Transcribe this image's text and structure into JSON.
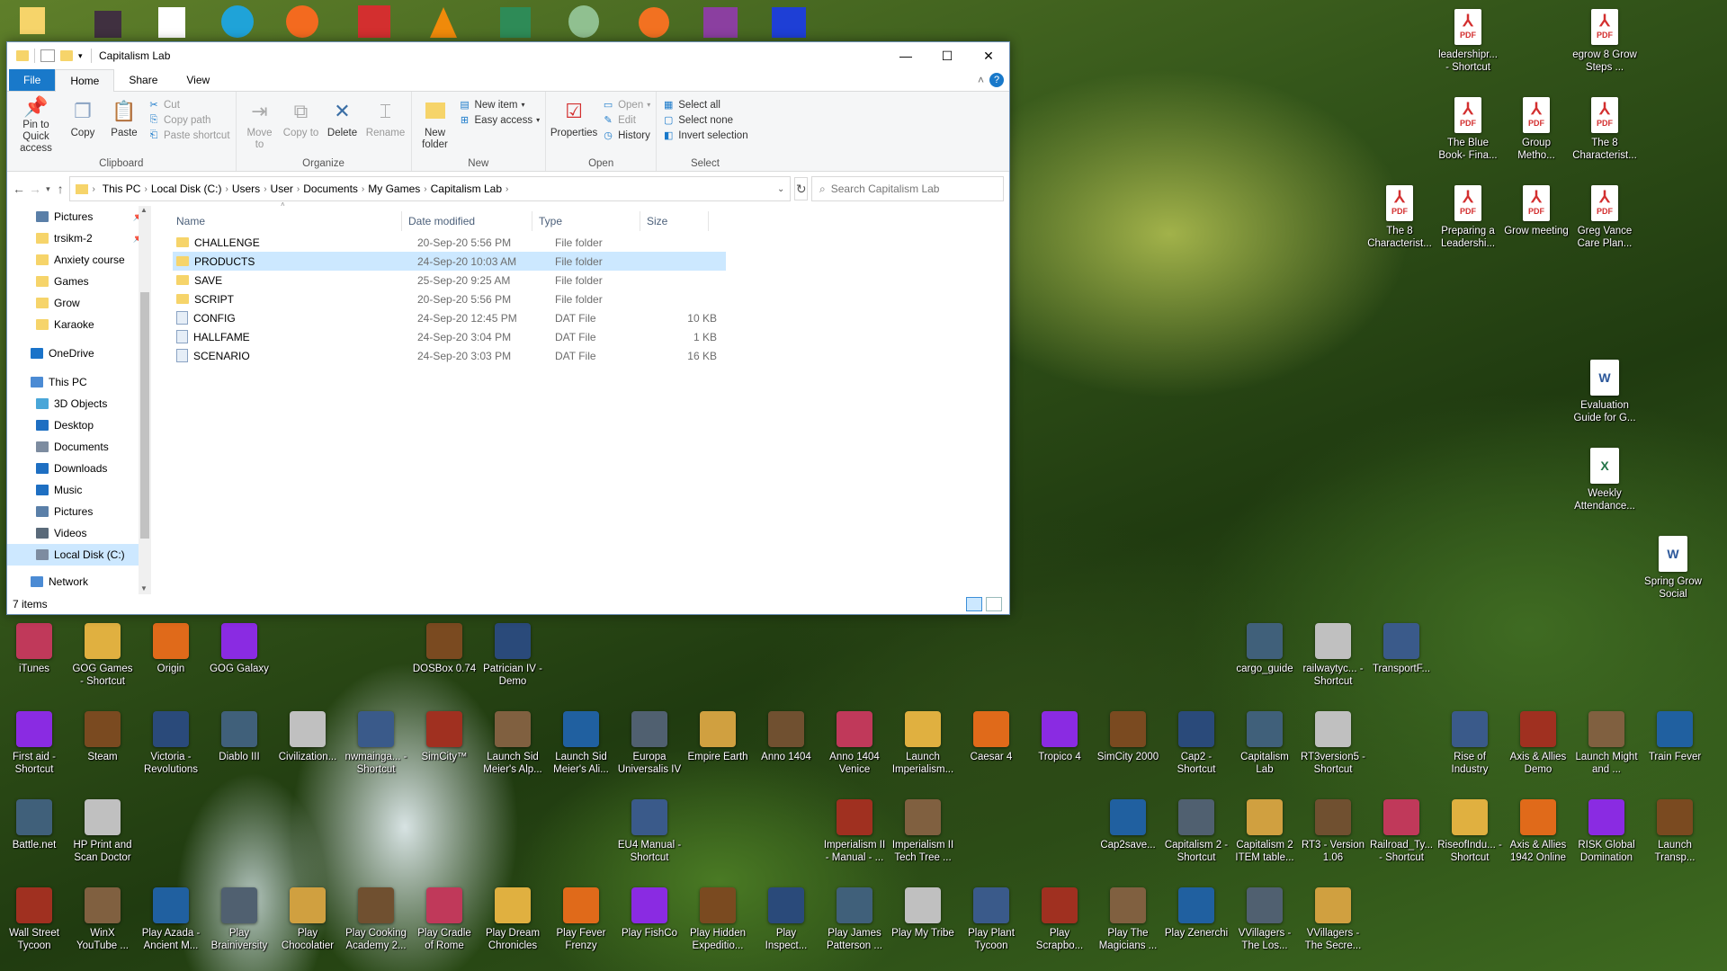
{
  "window": {
    "title": "Capitalism Lab",
    "tabs": [
      "File",
      "Home",
      "Share",
      "View"
    ],
    "help_icon": "?"
  },
  "ribbon": {
    "clipboard": {
      "name": "Clipboard",
      "pin": "Pin to Quick access",
      "copy": "Copy",
      "paste": "Paste",
      "cut": "Cut",
      "copy_path": "Copy path",
      "paste_shortcut": "Paste shortcut"
    },
    "organize": {
      "name": "Organize",
      "move_to": "Move to",
      "copy_to": "Copy to",
      "delete": "Delete",
      "rename": "Rename"
    },
    "new": {
      "name": "New",
      "new_folder": "New folder",
      "new_item": "New item",
      "easy_access": "Easy access"
    },
    "open": {
      "name": "Open",
      "properties": "Properties",
      "open": "Open",
      "edit": "Edit",
      "history": "History"
    },
    "select": {
      "name": "Select",
      "select_all": "Select all",
      "select_none": "Select none",
      "invert": "Invert selection"
    }
  },
  "address": {
    "crumbs": [
      "This PC",
      "Local Disk (C:)",
      "Users",
      "User",
      "Documents",
      "My Games",
      "Capitalism Lab"
    ],
    "search_placeholder": "Search Capitalism Lab"
  },
  "nav": {
    "quick": [
      {
        "label": "Pictures",
        "pinned": true
      },
      {
        "label": "trsikm-2",
        "pinned": true
      },
      {
        "label": "Anxiety course",
        "pinned": false
      },
      {
        "label": "Games",
        "pinned": false
      },
      {
        "label": "Grow",
        "pinned": false
      },
      {
        "label": "Karaoke",
        "pinned": false
      }
    ],
    "onedrive": "OneDrive",
    "thispc": "This PC",
    "pc_items": [
      "3D Objects",
      "Desktop",
      "Documents",
      "Downloads",
      "Music",
      "Pictures",
      "Videos",
      "Local Disk (C:)"
    ],
    "network": "Network"
  },
  "columns": {
    "name": "Name",
    "date": "Date modified",
    "type": "Type",
    "size": "Size"
  },
  "files": [
    {
      "name": "CHALLENGE",
      "date": "20-Sep-20 5:56 PM",
      "type": "File folder",
      "size": ""
    },
    {
      "name": "PRODUCTS",
      "date": "24-Sep-20 10:03 AM",
      "type": "File folder",
      "size": ""
    },
    {
      "name": "SAVE",
      "date": "25-Sep-20 9:25 AM",
      "type": "File folder",
      "size": ""
    },
    {
      "name": "SCRIPT",
      "date": "20-Sep-20 5:56 PM",
      "type": "File folder",
      "size": ""
    },
    {
      "name": "CONFIG",
      "date": "24-Sep-20 12:45 PM",
      "type": "DAT File",
      "size": "10 KB"
    },
    {
      "name": "HALLFAME",
      "date": "24-Sep-20 3:04 PM",
      "type": "DAT File",
      "size": "1 KB"
    },
    {
      "name": "SCENARIO",
      "date": "24-Sep-20 3:03 PM",
      "type": "DAT File",
      "size": "16 KB"
    }
  ],
  "status": "7 items",
  "desktop_right": [
    {
      "label": "leadershipr... - Shortcut",
      "kind": "pdf"
    },
    {
      "label": "egrow 8 Grow Steps ...",
      "kind": "pdf"
    },
    {
      "label": "The Blue Book- Fina...",
      "kind": "pdf"
    },
    {
      "label": "Group Metho...",
      "kind": "pdf"
    },
    {
      "label": "The 8 Characterist...",
      "kind": "pdf"
    },
    {
      "label": "The 8 Characterist...",
      "kind": "pdf"
    },
    {
      "label": "Preparing a Leadershi...",
      "kind": "pdf"
    },
    {
      "label": "Grow meeting",
      "kind": "pdf"
    },
    {
      "label": "Greg Vance Care Plan...",
      "kind": "pdf"
    },
    {
      "label": "Evaluation Guide for G...",
      "kind": "doc"
    },
    {
      "label": "Weekly Attendance...",
      "kind": "xls"
    },
    {
      "label": "Spring Grow Social",
      "kind": "doc"
    }
  ],
  "desktop_row1": [
    "iTunes",
    "GOG Games - Shortcut",
    "Origin",
    "GOG Galaxy",
    "DOSBox 0.74",
    "Patrician IV - Demo",
    "cargo_guide",
    "railwaytyc... - Shortcut",
    "TransportF..."
  ],
  "desktop_row2": [
    "First aid - Shortcut",
    "Steam",
    "Victoria - Revolutions",
    "Diablo III",
    "Civilization...",
    "nwmainga... - Shortcut",
    "SimCity™",
    "Launch Sid Meier's Alp...",
    "Launch Sid Meier's Ali...",
    "Europa Universalis IV",
    "Empire Earth",
    "Anno 1404",
    "Anno 1404 Venice",
    "Launch Imperialism...",
    "Caesar 4",
    "Tropico 4",
    "SimCity 2000",
    "Cap2 - Shortcut",
    "Capitalism Lab",
    "RT3version5 - Shortcut",
    "Rise of Industry",
    "Axis & Allies Demo",
    "Launch Might and ...",
    "Train Fever"
  ],
  "desktop_row3": [
    "Battle.net",
    "HP Print and Scan Doctor",
    "EU4 Manual - Shortcut",
    "Imperialism II - Manual - ...",
    "Imperialism II Tech Tree ...",
    "Cap2save...",
    "Capitalism 2 - Shortcut",
    "Capitalism 2 ITEM table...",
    "RT3 - Version 1.06",
    "Railroad_Ty... - Shortcut",
    "RiseofIndu... - Shortcut",
    "Axis & Allies 1942 Online",
    "RISK Global Domination",
    "Launch Transp..."
  ],
  "desktop_row4": [
    "Wall Street Tycoon",
    "WinX YouTube ...",
    "Play Azada - Ancient M...",
    "Play Brainiversity",
    "Play Chocolatier",
    "Play Cooking Academy 2...",
    "Play Cradle of Rome",
    "Play Dream Chronicles",
    "Play Fever Frenzy",
    "Play FishCo",
    "Play Hidden Expeditio...",
    "Play Inspect...",
    "Play James Patterson ...",
    "Play My Tribe",
    "Play Plant Tycoon",
    "Play Scrapbo...",
    "Play The Magicians ...",
    "Play Zenerchi",
    "VVillagers - The Los...",
    "VVillagers - The Secre..."
  ],
  "colors": {
    "accent": "#1979ca",
    "selection": "#cce8ff"
  }
}
